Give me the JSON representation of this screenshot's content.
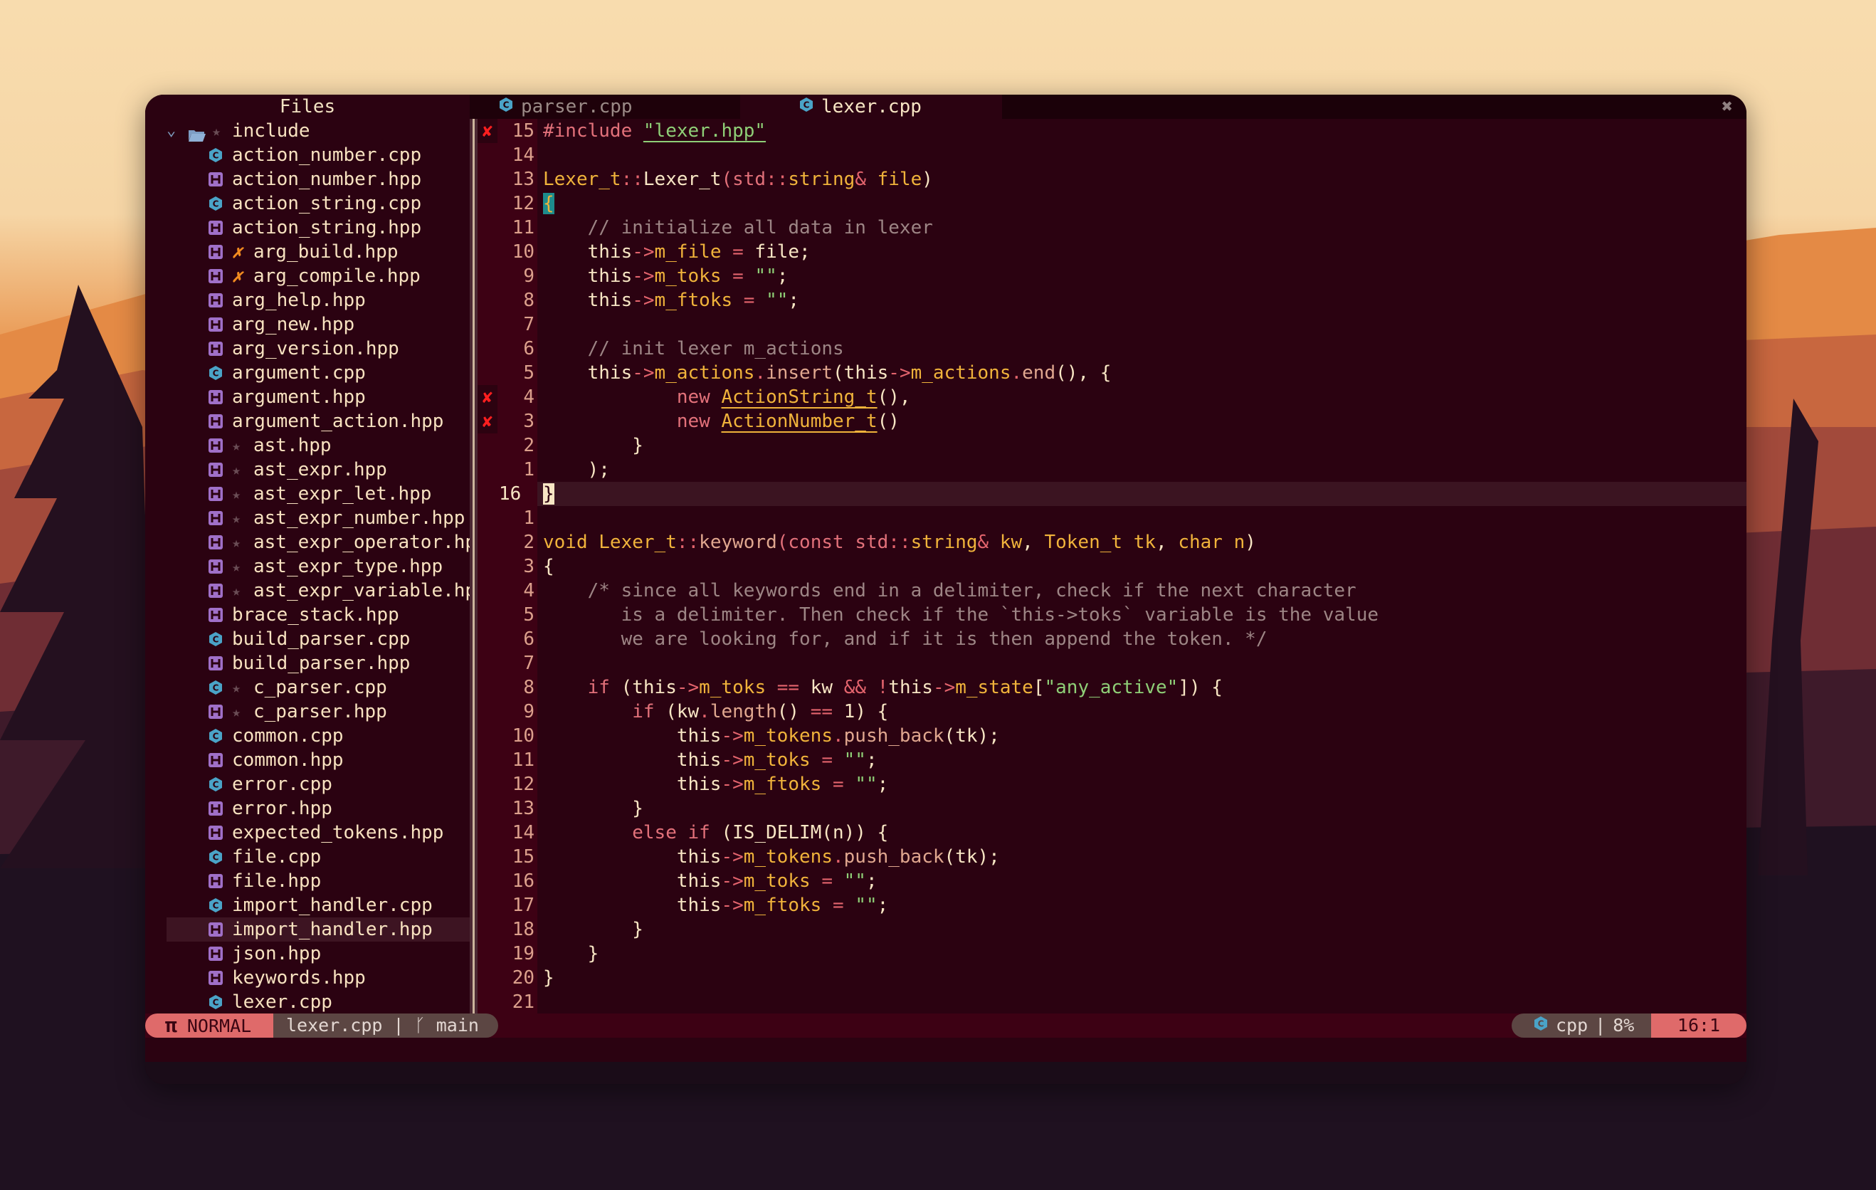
{
  "window": {
    "sidebar_title": "Files",
    "close_icon": "close-icon",
    "tabs": [
      {
        "label": "parser.cpp",
        "icon": "cpp-file-icon",
        "active": false
      },
      {
        "label": "lexer.cpp",
        "icon": "cpp-file-icon",
        "active": true
      }
    ]
  },
  "sidebar": {
    "folder": {
      "label": "include",
      "expanded": true,
      "starred": true
    },
    "items": [
      {
        "label": "action_number.cpp",
        "type": "cpp",
        "mark": ""
      },
      {
        "label": "action_number.hpp",
        "type": "hpp",
        "mark": ""
      },
      {
        "label": "action_string.cpp",
        "type": "cpp",
        "mark": ""
      },
      {
        "label": "action_string.hpp",
        "type": "hpp",
        "mark": ""
      },
      {
        "label": "arg_build.hpp",
        "type": "hpp",
        "mark": "x"
      },
      {
        "label": "arg_compile.hpp",
        "type": "hpp",
        "mark": "x"
      },
      {
        "label": "arg_help.hpp",
        "type": "hpp",
        "mark": ""
      },
      {
        "label": "arg_new.hpp",
        "type": "hpp",
        "mark": ""
      },
      {
        "label": "arg_version.hpp",
        "type": "hpp",
        "mark": ""
      },
      {
        "label": "argument.cpp",
        "type": "cpp",
        "mark": ""
      },
      {
        "label": "argument.hpp",
        "type": "hpp",
        "mark": ""
      },
      {
        "label": "argument_action.hpp",
        "type": "hpp",
        "mark": ""
      },
      {
        "label": "ast.hpp",
        "type": "hpp",
        "mark": "star"
      },
      {
        "label": "ast_expr.hpp",
        "type": "hpp",
        "mark": "star"
      },
      {
        "label": "ast_expr_let.hpp",
        "type": "hpp",
        "mark": "star"
      },
      {
        "label": "ast_expr_number.hpp",
        "type": "hpp",
        "mark": "star"
      },
      {
        "label": "ast_expr_operator.hp",
        "type": "hpp",
        "mark": "star"
      },
      {
        "label": "ast_expr_type.hpp",
        "type": "hpp",
        "mark": "star"
      },
      {
        "label": "ast_expr_variable.hp",
        "type": "hpp",
        "mark": "star"
      },
      {
        "label": "brace_stack.hpp",
        "type": "hpp",
        "mark": ""
      },
      {
        "label": "build_parser.cpp",
        "type": "cpp",
        "mark": ""
      },
      {
        "label": "build_parser.hpp",
        "type": "hpp",
        "mark": ""
      },
      {
        "label": "c_parser.cpp",
        "type": "cpp",
        "mark": "star"
      },
      {
        "label": "c_parser.hpp",
        "type": "hpp",
        "mark": "star"
      },
      {
        "label": "common.cpp",
        "type": "cpp",
        "mark": ""
      },
      {
        "label": "common.hpp",
        "type": "hpp",
        "mark": ""
      },
      {
        "label": "error.cpp",
        "type": "cpp",
        "mark": ""
      },
      {
        "label": "error.hpp",
        "type": "hpp",
        "mark": ""
      },
      {
        "label": "expected_tokens.hpp",
        "type": "hpp",
        "mark": ""
      },
      {
        "label": "file.cpp",
        "type": "cpp",
        "mark": ""
      },
      {
        "label": "file.hpp",
        "type": "hpp",
        "mark": ""
      },
      {
        "label": "import_handler.cpp",
        "type": "cpp",
        "mark": ""
      },
      {
        "label": "import_handler.hpp",
        "type": "hpp",
        "mark": "",
        "selected": true
      },
      {
        "label": "json.hpp",
        "type": "hpp",
        "mark": ""
      },
      {
        "label": "keywords.hpp",
        "type": "hpp",
        "mark": ""
      },
      {
        "label": "lexer.cpp",
        "type": "cpp",
        "mark": ""
      }
    ]
  },
  "editor": {
    "lines": [
      {
        "num": "15",
        "sign": "error",
        "tokens": [
          [
            "pre",
            "#include "
          ],
          [
            "str-ul",
            "\"lexer.hpp\""
          ]
        ]
      },
      {
        "num": "14",
        "sign": "",
        "tokens": []
      },
      {
        "num": "13",
        "sign": "",
        "tokens": [
          [
            "type",
            "Lexer_t"
          ],
          [
            "op",
            "::"
          ],
          [
            "plain",
            "Lexer_t"
          ],
          [
            "kw",
            "("
          ],
          [
            "kw",
            "std"
          ],
          [
            "op",
            "::"
          ],
          [
            "type",
            "string"
          ],
          [
            "op",
            "&"
          ],
          [
            "plain",
            " "
          ],
          [
            "type",
            "file"
          ],
          [
            "plain",
            ")"
          ]
        ]
      },
      {
        "num": "12",
        "sign": "",
        "tokens": [
          [
            "brace",
            "{"
          ]
        ]
      },
      {
        "num": "11",
        "sign": "",
        "tokens": [
          [
            "plain",
            "    "
          ],
          [
            "cmt",
            "// initialize all data in lexer"
          ]
        ]
      },
      {
        "num": "10",
        "sign": "",
        "tokens": [
          [
            "plain",
            "    this"
          ],
          [
            "op",
            "->"
          ],
          [
            "memb",
            "m_file"
          ],
          [
            "plain",
            " "
          ],
          [
            "op",
            "="
          ],
          [
            "plain",
            " file;"
          ]
        ]
      },
      {
        "num": "9",
        "sign": "",
        "tokens": [
          [
            "plain",
            "    this"
          ],
          [
            "op",
            "->"
          ],
          [
            "memb",
            "m_toks"
          ],
          [
            "plain",
            " "
          ],
          [
            "op",
            "="
          ],
          [
            "plain",
            " "
          ],
          [
            "str",
            "\"\""
          ],
          [
            "plain",
            ";"
          ]
        ]
      },
      {
        "num": "8",
        "sign": "",
        "tokens": [
          [
            "plain",
            "    this"
          ],
          [
            "op",
            "->"
          ],
          [
            "memb",
            "m_ftoks"
          ],
          [
            "plain",
            " "
          ],
          [
            "op",
            "="
          ],
          [
            "plain",
            " "
          ],
          [
            "str",
            "\"\""
          ],
          [
            "plain",
            ";"
          ]
        ]
      },
      {
        "num": "7",
        "sign": "",
        "tokens": []
      },
      {
        "num": "6",
        "sign": "",
        "tokens": [
          [
            "plain",
            "    "
          ],
          [
            "cmt",
            "// init lexer m_actions"
          ]
        ]
      },
      {
        "num": "5",
        "sign": "",
        "tokens": [
          [
            "plain",
            "    this"
          ],
          [
            "op",
            "->"
          ],
          [
            "memb",
            "m_actions"
          ],
          [
            "op",
            "."
          ],
          [
            "fn",
            "insert"
          ],
          [
            "plain",
            "(this"
          ],
          [
            "op",
            "->"
          ],
          [
            "memb",
            "m_actions"
          ],
          [
            "op",
            "."
          ],
          [
            "fn",
            "end"
          ],
          [
            "plain",
            "(), {"
          ]
        ]
      },
      {
        "num": "4",
        "sign": "error",
        "tokens": [
          [
            "plain",
            "            "
          ],
          [
            "kw",
            "new"
          ],
          [
            "plain",
            " "
          ],
          [
            "type-ul",
            "ActionString_t"
          ],
          [
            "plain",
            "(),"
          ]
        ]
      },
      {
        "num": "3",
        "sign": "error",
        "tokens": [
          [
            "plain",
            "            "
          ],
          [
            "kw",
            "new"
          ],
          [
            "plain",
            " "
          ],
          [
            "type-ul",
            "ActionNumber_t"
          ],
          [
            "plain",
            "()"
          ]
        ]
      },
      {
        "num": "2",
        "sign": "",
        "tokens": [
          [
            "plain",
            "        }"
          ]
        ]
      },
      {
        "num": "1",
        "sign": "",
        "tokens": [
          [
            "plain",
            "    );"
          ]
        ]
      },
      {
        "num": "16",
        "sign": "",
        "current": true,
        "tokens": [
          [
            "cursor",
            "}"
          ]
        ]
      },
      {
        "num": "1",
        "sign": "",
        "tokens": []
      },
      {
        "num": "2",
        "sign": "",
        "tokens": [
          [
            "type",
            "void"
          ],
          [
            "plain",
            " "
          ],
          [
            "type",
            "Lexer_t"
          ],
          [
            "op",
            "::"
          ],
          [
            "fn",
            "keyword"
          ],
          [
            "kw",
            "("
          ],
          [
            "kw",
            "const std"
          ],
          [
            "op",
            "::"
          ],
          [
            "type",
            "string"
          ],
          [
            "op",
            "&"
          ],
          [
            "plain",
            " "
          ],
          [
            "type",
            "kw"
          ],
          [
            "plain",
            ", "
          ],
          [
            "type",
            "Token_t"
          ],
          [
            "plain",
            " "
          ],
          [
            "type",
            "tk"
          ],
          [
            "plain",
            ", "
          ],
          [
            "type",
            "char n"
          ],
          [
            "plain",
            ")"
          ]
        ]
      },
      {
        "num": "3",
        "sign": "",
        "tokens": [
          [
            "plain",
            "{"
          ]
        ]
      },
      {
        "num": "4",
        "sign": "",
        "tokens": [
          [
            "plain",
            "    "
          ],
          [
            "cmt",
            "/* since all keywords end in a delimiter, check if the next character"
          ]
        ]
      },
      {
        "num": "5",
        "sign": "",
        "tokens": [
          [
            "plain",
            "       "
          ],
          [
            "cmt",
            "is a delimiter. Then check if the `this->toks` variable is the value"
          ]
        ]
      },
      {
        "num": "6",
        "sign": "",
        "tokens": [
          [
            "plain",
            "       "
          ],
          [
            "cmt",
            "we are looking for, and if it is then append the token. */"
          ]
        ]
      },
      {
        "num": "7",
        "sign": "",
        "tokens": []
      },
      {
        "num": "8",
        "sign": "",
        "tokens": [
          [
            "plain",
            "    "
          ],
          [
            "kw",
            "if"
          ],
          [
            "plain",
            " (this"
          ],
          [
            "op",
            "->"
          ],
          [
            "memb",
            "m_toks"
          ],
          [
            "plain",
            " "
          ],
          [
            "op",
            "=="
          ],
          [
            "plain",
            " kw "
          ],
          [
            "op",
            "&&"
          ],
          [
            "plain",
            " "
          ],
          [
            "op",
            "!"
          ],
          [
            "plain",
            "this"
          ],
          [
            "op",
            "->"
          ],
          [
            "memb",
            "m_state"
          ],
          [
            "plain",
            "["
          ],
          [
            "str",
            "\"any_active\""
          ],
          [
            "plain",
            "]) {"
          ]
        ]
      },
      {
        "num": "9",
        "sign": "",
        "tokens": [
          [
            "plain",
            "        "
          ],
          [
            "kw",
            "if"
          ],
          [
            "plain",
            " (kw"
          ],
          [
            "op",
            "."
          ],
          [
            "fn",
            "length"
          ],
          [
            "plain",
            "() "
          ],
          [
            "op",
            "=="
          ],
          [
            "plain",
            " 1) {"
          ]
        ]
      },
      {
        "num": "10",
        "sign": "",
        "tokens": [
          [
            "plain",
            "            this"
          ],
          [
            "op",
            "->"
          ],
          [
            "memb",
            "m_tokens"
          ],
          [
            "op",
            "."
          ],
          [
            "fn",
            "push_back"
          ],
          [
            "plain",
            "(tk);"
          ]
        ]
      },
      {
        "num": "11",
        "sign": "",
        "tokens": [
          [
            "plain",
            "            this"
          ],
          [
            "op",
            "->"
          ],
          [
            "memb",
            "m_toks"
          ],
          [
            "plain",
            " "
          ],
          [
            "op",
            "="
          ],
          [
            "plain",
            " "
          ],
          [
            "str",
            "\"\""
          ],
          [
            "plain",
            ";"
          ]
        ]
      },
      {
        "num": "12",
        "sign": "",
        "tokens": [
          [
            "plain",
            "            this"
          ],
          [
            "op",
            "->"
          ],
          [
            "memb",
            "m_ftoks"
          ],
          [
            "plain",
            " "
          ],
          [
            "op",
            "="
          ],
          [
            "plain",
            " "
          ],
          [
            "str",
            "\"\""
          ],
          [
            "plain",
            ";"
          ]
        ]
      },
      {
        "num": "13",
        "sign": "",
        "tokens": [
          [
            "plain",
            "        }"
          ]
        ]
      },
      {
        "num": "14",
        "sign": "",
        "tokens": [
          [
            "plain",
            "        "
          ],
          [
            "kw",
            "else if"
          ],
          [
            "plain",
            " (IS_DELIM(n)) {"
          ]
        ]
      },
      {
        "num": "15",
        "sign": "",
        "tokens": [
          [
            "plain",
            "            this"
          ],
          [
            "op",
            "->"
          ],
          [
            "memb",
            "m_tokens"
          ],
          [
            "op",
            "."
          ],
          [
            "fn",
            "push_back"
          ],
          [
            "plain",
            "(tk);"
          ]
        ]
      },
      {
        "num": "16",
        "sign": "",
        "tokens": [
          [
            "plain",
            "            this"
          ],
          [
            "op",
            "->"
          ],
          [
            "memb",
            "m_toks"
          ],
          [
            "plain",
            " "
          ],
          [
            "op",
            "="
          ],
          [
            "plain",
            " "
          ],
          [
            "str",
            "\"\""
          ],
          [
            "plain",
            ";"
          ]
        ]
      },
      {
        "num": "17",
        "sign": "",
        "tokens": [
          [
            "plain",
            "            this"
          ],
          [
            "op",
            "->"
          ],
          [
            "memb",
            "m_ftoks"
          ],
          [
            "plain",
            " "
          ],
          [
            "op",
            "="
          ],
          [
            "plain",
            " "
          ],
          [
            "str",
            "\"\""
          ],
          [
            "plain",
            ";"
          ]
        ]
      },
      {
        "num": "18",
        "sign": "",
        "tokens": [
          [
            "plain",
            "        }"
          ]
        ]
      },
      {
        "num": "19",
        "sign": "",
        "tokens": [
          [
            "plain",
            "    }"
          ]
        ]
      },
      {
        "num": "20",
        "sign": "",
        "tokens": [
          [
            "plain",
            "}"
          ]
        ]
      },
      {
        "num": "21",
        "sign": "",
        "tokens": []
      }
    ]
  },
  "statusline": {
    "mode_icon": "π",
    "mode": "NORMAL",
    "filename": "lexer.cpp",
    "separator": "|",
    "branch_icon": "ᚴ",
    "branch": "main",
    "filetype": "cpp",
    "percent": "8%",
    "position": "16:1"
  },
  "colors": {
    "background": "#2b0211",
    "accent": "#df6a6a",
    "error": "#ff1f1f",
    "cpp_icon": "#4aa3c7",
    "hpp_icon": "#a070c8"
  }
}
